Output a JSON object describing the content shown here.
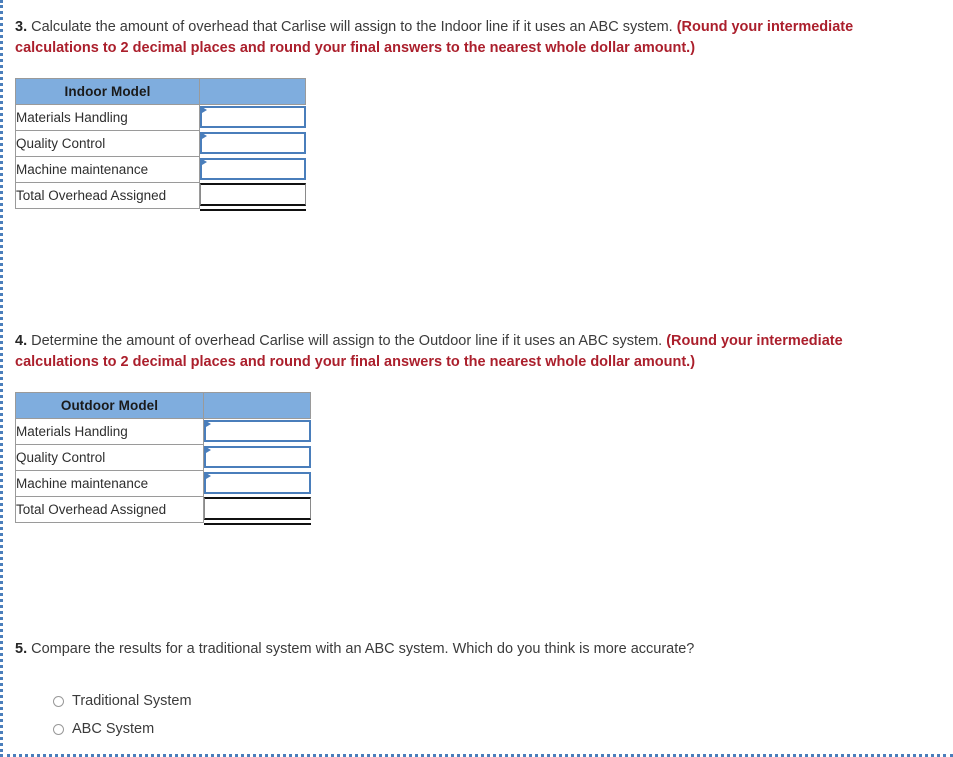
{
  "questions": [
    {
      "number": "3.",
      "text": "Calculate the amount of overhead that Carlise will assign to the Indoor line if it uses an ABC system.",
      "emphasis": "(Round your intermediate calculations to 2 decimal places and round your final answers to the nearest whole dollar amount.)"
    },
    {
      "number": "4.",
      "text": "Determine the amount of overhead Carlise will assign to the Outdoor line if it uses an ABC system.",
      "emphasis": "(Round your intermediate calculations to 2 decimal places and round your final answers to the nearest whole dollar amount.)"
    },
    {
      "number": "5.",
      "text": "Compare the results for a traditional system with an ABC system. Which do you think is more accurate?",
      "emphasis": ""
    }
  ],
  "tables": [
    {
      "header": "Indoor Model",
      "header_blank": "",
      "rows": [
        {
          "label": "Materials Handling",
          "value": "",
          "type": "input"
        },
        {
          "label": "Quality Control",
          "value": "",
          "type": "input"
        },
        {
          "label": "Machine maintenance",
          "value": "",
          "type": "input"
        },
        {
          "label": "Total Overhead Assigned",
          "value": "",
          "type": "total"
        }
      ]
    },
    {
      "header": "Outdoor Model",
      "header_blank": "",
      "rows": [
        {
          "label": "Materials Handling",
          "value": "",
          "type": "input"
        },
        {
          "label": "Quality Control",
          "value": "",
          "type": "input"
        },
        {
          "label": "Machine maintenance",
          "value": "",
          "type": "input"
        },
        {
          "label": "Total Overhead Assigned",
          "value": "",
          "type": "total"
        }
      ]
    }
  ],
  "options": [
    {
      "label": "Traditional System",
      "selected": false
    },
    {
      "label": "ABC System",
      "selected": false
    }
  ],
  "colors": {
    "header_blue": "#7fadde",
    "input_border_blue": "#4a7ebb",
    "emphasis_red": "#ab1f2c",
    "frame_dotted": "#4a7ebb",
    "body_text": "#3b3b3b"
  }
}
